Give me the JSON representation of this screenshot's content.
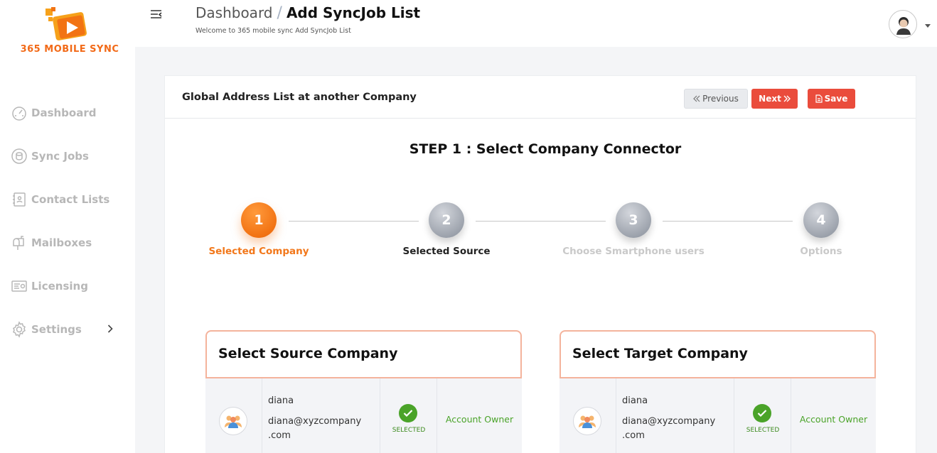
{
  "brand": {
    "name": "365 MOBILE SYNC",
    "color": "#f26a18"
  },
  "sidebar": {
    "items": [
      {
        "label": "Dashboard",
        "icon": "speedometer-icon"
      },
      {
        "label": "Sync Jobs",
        "icon": "sync-database-icon"
      },
      {
        "label": "Contact Lists",
        "icon": "contact-book-icon"
      },
      {
        "label": "Mailboxes",
        "icon": "mailbox-icon"
      },
      {
        "label": "Licensing",
        "icon": "license-card-icon"
      },
      {
        "label": "Settings",
        "icon": "gear-icon"
      }
    ]
  },
  "header": {
    "breadcrumb_root": "Dashboard",
    "breadcrumb_separator": "/",
    "breadcrumb_current": "Add SyncJob List",
    "subtitle": "Welcome to 365 mobile sync Add SyncJob List"
  },
  "card": {
    "title": "Global Address List at another Company",
    "buttons": {
      "previous": "Previous",
      "next": "Next",
      "save": "Save"
    }
  },
  "step_title": "STEP 1 : Select Company Connector",
  "steps": [
    {
      "number": "1",
      "label": "Selected Company",
      "state": "active"
    },
    {
      "number": "2",
      "label": "Selected Source",
      "state": "current"
    },
    {
      "number": "3",
      "label": "Choose Smartphone users",
      "state": "muted"
    },
    {
      "number": "4",
      "label": "Options",
      "state": "muted"
    }
  ],
  "source_panel": {
    "title": "Select Source Company",
    "row": {
      "name": "diana",
      "email": "diana@xyzcompany .com",
      "status": "SELECTED",
      "role": "Account Owner"
    }
  },
  "target_panel": {
    "title": "Select Target Company",
    "row": {
      "name": "diana",
      "email": "diana@xyzcompany .com",
      "status": "SELECTED",
      "role": "Account Owner"
    }
  },
  "colors": {
    "accent": "#ea4c3c",
    "step_active": "#f27313",
    "success": "#4aa329",
    "panel_border": "#f4b39c"
  }
}
